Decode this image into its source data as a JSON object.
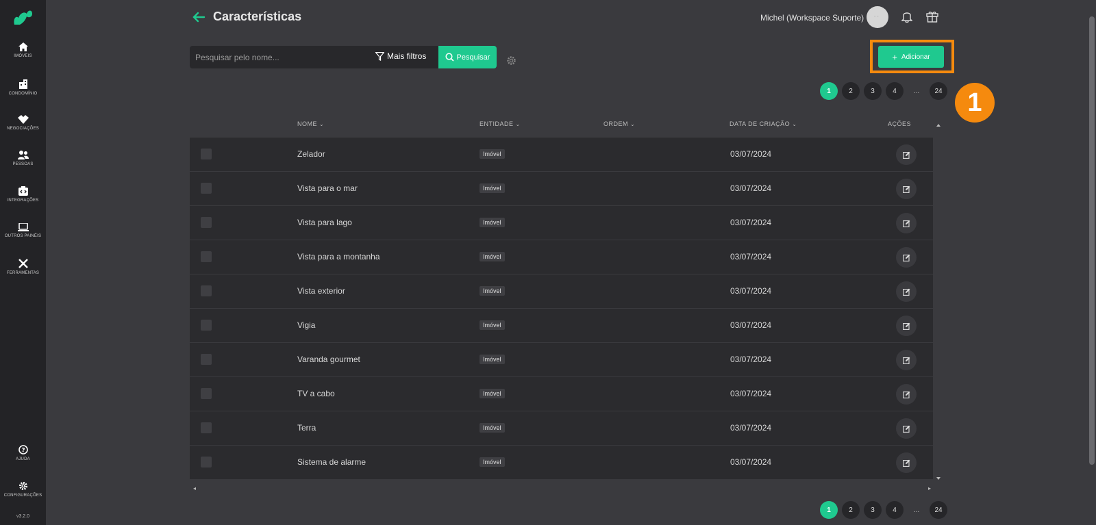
{
  "sidebar": {
    "items": [
      {
        "label": "Imóveis",
        "icon": "home-icon"
      },
      {
        "label": "Condomínio",
        "icon": "building-icon"
      },
      {
        "label": "Negociações",
        "icon": "handshake-icon"
      },
      {
        "label": "Pessoas",
        "icon": "people-icon"
      },
      {
        "label": "Integrações",
        "icon": "integrations-icon"
      },
      {
        "label": "Outros painéis",
        "icon": "laptop-icon"
      },
      {
        "label": "Ferramentas",
        "icon": "tools-icon"
      }
    ],
    "help_label": "Ajuda",
    "settings_label": "Configurações",
    "version": "v3.2.0"
  },
  "header": {
    "title": "Características",
    "user_name": "Michel (Workspace Suporte)",
    "avatar_text": "- -"
  },
  "toolbar": {
    "search_placeholder": "Pesquisar pelo nome...",
    "filters_label": "Mais filtros",
    "search_label": "Pesquisar",
    "add_label": "Adicionar"
  },
  "annotation": {
    "step": "1"
  },
  "pagination": {
    "pages": [
      "1",
      "2",
      "3",
      "4"
    ],
    "ellipsis": "...",
    "last": "24",
    "current": "1"
  },
  "table": {
    "columns": {
      "name": "NOME",
      "entity": "ENTIDADE",
      "order": "ORDEM",
      "created": "DATA DE CRIAÇÃO",
      "actions": "AÇÕES"
    },
    "rows": [
      {
        "name": "Zelador",
        "entity": "Imóvel",
        "date": "03/07/2024"
      },
      {
        "name": "Vista para o mar",
        "entity": "Imóvel",
        "date": "03/07/2024"
      },
      {
        "name": "Vista para lago",
        "entity": "Imóvel",
        "date": "03/07/2024"
      },
      {
        "name": "Vista para a montanha",
        "entity": "Imóvel",
        "date": "03/07/2024"
      },
      {
        "name": "Vista exterior",
        "entity": "Imóvel",
        "date": "03/07/2024"
      },
      {
        "name": "Vigia",
        "entity": "Imóvel",
        "date": "03/07/2024"
      },
      {
        "name": "Varanda gourmet",
        "entity": "Imóvel",
        "date": "03/07/2024"
      },
      {
        "name": "TV a cabo",
        "entity": "Imóvel",
        "date": "03/07/2024"
      },
      {
        "name": "Terra",
        "entity": "Imóvel",
        "date": "03/07/2024"
      },
      {
        "name": "Sistema de alarme",
        "entity": "Imóvel",
        "date": "03/07/2024"
      }
    ]
  },
  "colors": {
    "accent": "#1fc98f",
    "highlight": "#f58a0e",
    "sidebar": "#232326",
    "background": "#3a3a3e"
  }
}
